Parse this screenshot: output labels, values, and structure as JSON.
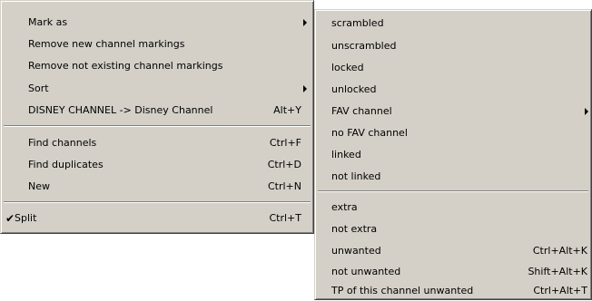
{
  "main_menu": {
    "items": [
      {
        "label": "Mark as",
        "submenu": true
      },
      {
        "label": "Remove new channel markings"
      },
      {
        "label": "Remove not existing channel markings"
      },
      {
        "label": "Sort",
        "submenu": true
      },
      {
        "label": "DISNEY CHANNEL -> Disney Channel",
        "shortcut": "Alt+Y"
      },
      {
        "label": "Find channels",
        "shortcut": "Ctrl+F"
      },
      {
        "label": "Find duplicates",
        "shortcut": "Ctrl+D"
      },
      {
        "label": "New",
        "shortcut": "Ctrl+N"
      },
      {
        "label": "Split",
        "shortcut": "Ctrl+T",
        "checked": true,
        "check_glyph": "✔"
      }
    ]
  },
  "sub_menu": {
    "items": [
      {
        "label": "scrambled"
      },
      {
        "label": "unscrambled"
      },
      {
        "label": "locked"
      },
      {
        "label": "unlocked"
      },
      {
        "label": "FAV channel",
        "submenu": true
      },
      {
        "label": "no FAV channel"
      },
      {
        "label": "linked"
      },
      {
        "label": "not linked"
      },
      {
        "label": "extra"
      },
      {
        "label": "not extra"
      },
      {
        "label": "unwanted",
        "shortcut": "Ctrl+Alt+K"
      },
      {
        "label": "not unwanted",
        "shortcut": "Shift+Alt+K"
      },
      {
        "label": "TP of this channel unwanted",
        "shortcut": "Ctrl+Alt+T"
      }
    ]
  },
  "colors": {
    "menu_face": "#d4d0c8",
    "menu_shadow": "#808080",
    "menu_highlight": "#ffffff",
    "text": "#000000"
  }
}
